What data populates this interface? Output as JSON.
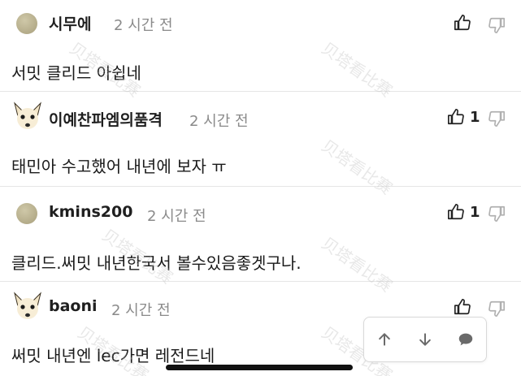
{
  "comments": [
    {
      "username": "시무에",
      "time": "2 시간 전",
      "text": "서밋 클리드 아쉽네",
      "likes": "",
      "avatar": "circle-avatar"
    },
    {
      "username": "이예찬파엠의품격",
      "time": "2 시간 전",
      "text": "태민아 수고했어 내년에 보자 ㅠ",
      "likes": "1",
      "avatar": "dog-avatar"
    },
    {
      "username": "kmins200",
      "time": "2 시간 전",
      "text": "클리드.써밋 내년한국서 볼수있음좋겟구나.",
      "likes": "1",
      "avatar": "circle-avatar"
    },
    {
      "username": "baoni",
      "time": "2 시간 전",
      "text": "써밋 내년엔 lec가면 레전드네",
      "likes": "",
      "avatar": "dog-avatar"
    }
  ],
  "watermark": "贝塔看比赛",
  "float_bar": {
    "icons": [
      "arrow-up-icon",
      "arrow-down-icon",
      "chat-bubble-icon"
    ]
  },
  "colors": {
    "text": "#1a1a1a",
    "muted": "#8a8a8a",
    "divider": "#e6e6e6",
    "icon": "#222222",
    "icon_muted": "#b0b0b0"
  }
}
